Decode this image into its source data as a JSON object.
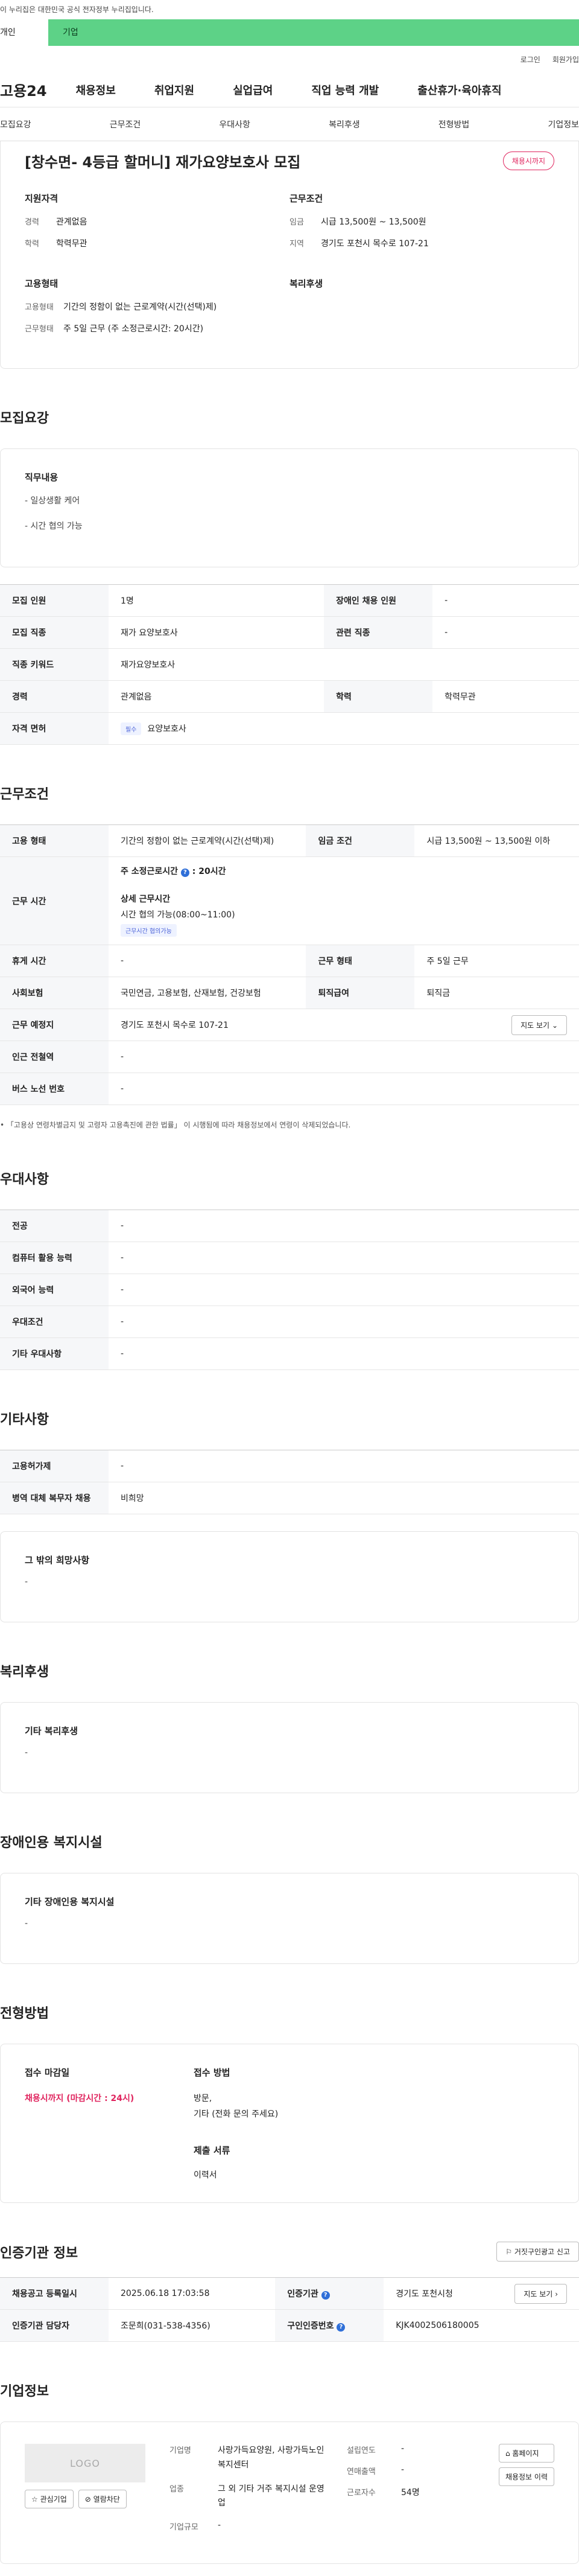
{
  "top_note": "이 누리집은 대한민국 공식 전자정부 누리집입니다.",
  "tabs": {
    "person": "개인",
    "corp": "기업"
  },
  "utility": {
    "login": "로그인",
    "signup": "회원가입"
  },
  "gnb": {
    "logo": "고용24",
    "items": [
      "채용정보",
      "취업지원",
      "실업급여",
      "직업 능력 개발",
      "출산휴가·육아휴직"
    ]
  },
  "subnav": [
    "모집요강",
    "근무조건",
    "우대사항",
    "복리후생",
    "전형방법",
    "기업정보"
  ],
  "summary": {
    "title": "[창수면- 4등급 할머니] 재가요양보호사 모집",
    "badge": "채용시까지",
    "qual": {
      "heading": "지원자격",
      "career_k": "경력",
      "career_v": "관계없음",
      "edu_k": "학력",
      "edu_v": "학력무관"
    },
    "work": {
      "heading": "근무조건",
      "wage_k": "임금",
      "wage_v": "시급 13,500원 ~ 13,500원",
      "region_k": "지역",
      "region_v": "경기도 포천시 목수로 107-21"
    },
    "emp": {
      "heading": "고용형태",
      "type_k": "고용형태",
      "type_v": "기간의 정함이 없는 근로계약(시간(선택)제)",
      "form_k": "근무형태",
      "form_v": "주 5일 근무 (주 소정근로시간: 20시간)"
    },
    "welfare": {
      "heading": "복리후생"
    }
  },
  "recruit": {
    "section": "모집요강",
    "job_heading": "직무내용",
    "job_lines": [
      "- 일상생활 케어",
      "- 시간 협의 가능"
    ],
    "rows": {
      "count_k": "모집 인원",
      "count_v": "1명",
      "disabled_k": "장애인 채용 인원",
      "disabled_v": "-",
      "job_k": "모집 직종",
      "job_v": "재가 요양보호사",
      "rel_k": "관련 직종",
      "rel_v": "-",
      "kw_k": "직종 키워드",
      "kw_v": "재가요양보호사",
      "career_k": "경력",
      "career_v": "관계없음",
      "edu_k": "학력",
      "edu_v": "학력무관",
      "lic_k": "자격 면허",
      "lic_badge": "필수",
      "lic_v": "요양보호사"
    }
  },
  "conditions": {
    "section": "근무조건",
    "emp_k": "고용 형태",
    "emp_v": "기간의 정함이 없는 근로계약(시간(선택)제)",
    "wage_k": "임금 조건",
    "wage_v": "시급 13,500원 ~ 13,500원 이하",
    "time_k": "근무 시간",
    "weekly_label": "주 소정근로시간",
    "weekly_v": ": 20시간",
    "detail_label": "상세 근무시간",
    "detail_v": "시간 협의 가능(08:00~11:00)",
    "time_badge": "근무시간 협의가능",
    "rest_k": "휴게 시간",
    "rest_v": "-",
    "form_k": "근무 형태",
    "form_v": "주 5일 근무",
    "ins_k": "사회보험",
    "ins_v": "국민연금, 고용보험, 산재보험, 건강보험",
    "sev_k": "퇴직급여",
    "sev_v": "퇴직금",
    "place_k": "근무 예정지",
    "place_v": "경기도 포천시 목수로 107-21",
    "map_btn": "지도 보기",
    "subway_k": "인근 전철역",
    "subway_v": "-",
    "bus_k": "버스 노선 번호",
    "bus_v": "-",
    "note": "「고용상 연령차별금지 및 고령자 고용촉진에 관한 법률」 이 시행됨에 따라 채용정보에서 연령이 삭제되었습니다."
  },
  "preference": {
    "section": "우대사항",
    "rows": [
      {
        "k": "전공",
        "v": "-"
      },
      {
        "k": "컴퓨터 활용 능력",
        "v": "-"
      },
      {
        "k": "외국어 능력",
        "v": "-"
      },
      {
        "k": "우대조건",
        "v": "-"
      },
      {
        "k": "기타 우대사항",
        "v": "-"
      }
    ]
  },
  "etc": {
    "section": "기타사항",
    "rows": [
      {
        "k": "고용허가제",
        "v": "-"
      },
      {
        "k": "병역 대체 복무자 채용",
        "v": "비희망"
      }
    ],
    "wish_heading": "그 밖의 희망사항",
    "wish_v": "-"
  },
  "welfare": {
    "section": "복리후생",
    "heading": "기타 복리후생",
    "v": "-"
  },
  "disability": {
    "section": "장애인용 복지시설",
    "heading": "기타 장애인용 복지시설",
    "v": "-"
  },
  "method": {
    "section": "전형방법",
    "deadline_heading": "접수 마감일",
    "deadline_v": "채용시까지 (마감시간 : 24시)",
    "how_heading": "접수 방법",
    "how_v1": "방문,",
    "how_v2": "기타 (전화 문의 주세요)",
    "docs_heading": "제출 서류",
    "docs_v": "이력서"
  },
  "cert": {
    "section": "인증기관 정보",
    "report_btn": "거짓구인광고 신고",
    "reg_k": "채용공고 등록일시",
    "reg_v": "2025.06.18 17:03:58",
    "org_k": "인증기관",
    "org_v": "경기도 포천시청",
    "map_btn": "지도 보기",
    "mgr_k": "인증기관 담당자",
    "mgr_v": "조문희(031-538-4356)",
    "num_k": "구인인증번호",
    "num_v": "KJK4002506180005"
  },
  "company": {
    "section": "기업정보",
    "logo": "LOGO",
    "fav_btn": "관심기업",
    "block_btn": "열람차단",
    "name_k": "기업명",
    "name_v": "사랑가득요양원, 사랑가득노인복지센터",
    "year_k": "설립연도",
    "year_v": "-",
    "sales_k": "연매출액",
    "sales_v": "-",
    "staff_k": "근로자수",
    "staff_v": "54명",
    "ind_k": "업종",
    "ind_v": "그 외 기타 거주 복지시설 운영업",
    "size_k": "기업규모",
    "size_v": "-",
    "home_btn": "홈페이지",
    "info_btn": "채용정보 이력"
  }
}
